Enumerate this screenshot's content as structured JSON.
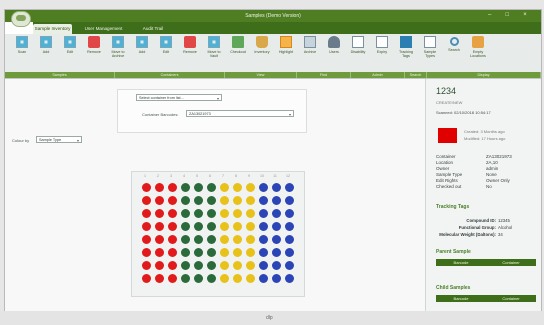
{
  "window": {
    "title": "Samples (Demo Version)",
    "controls": [
      "–",
      "□",
      "×"
    ]
  },
  "tabs": [
    "Sample Inventory",
    "User Management",
    "Audit Trail"
  ],
  "ribbon": {
    "buttons": [
      {
        "label": "Scan",
        "icon": "grid-icon"
      },
      {
        "label": "Add",
        "icon": "grid-icon"
      },
      {
        "label": "Edit",
        "icon": "grid-icon"
      },
      {
        "label": "Remove",
        "icon": "trash-icon"
      },
      {
        "label": "Move to Archive",
        "icon": "grid-icon"
      },
      {
        "label": "Add",
        "icon": "grid-icon"
      },
      {
        "label": "Edit",
        "icon": "grid-icon"
      },
      {
        "label": "Remove",
        "icon": "trash-icon"
      },
      {
        "label": "Move to Vault",
        "icon": "grid-icon"
      },
      {
        "label": "Checkout",
        "icon": "check-icon"
      },
      {
        "label": "Inventory",
        "icon": "bucket-icon"
      },
      {
        "label": "Highlight",
        "icon": "highlight-icon"
      },
      {
        "label": "Archive",
        "icon": "film-icon"
      },
      {
        "label": "Users",
        "icon": "person-icon"
      },
      {
        "label": "Disability",
        "icon": "doc-icon"
      },
      {
        "label": "Expiry",
        "icon": "doc-icon"
      },
      {
        "label": "Tracking Tags",
        "icon": "list-icon"
      },
      {
        "label": "Sample Types",
        "icon": "doc-icon"
      },
      {
        "label": "Search",
        "icon": "search-icon"
      },
      {
        "label": "Empty Locations",
        "icon": "box-icon"
      }
    ],
    "groups": [
      "Samples",
      "Containers",
      "View",
      "Find",
      "Admin",
      "Search",
      "Display"
    ]
  },
  "main": {
    "container_select_placeholder": "Select container from list...",
    "container_barcodes_label": "Container Barcodes:",
    "container_barcodes_value": "ZA13021973",
    "colour_by_label": "Colour by",
    "colour_by_value": "Sample Type",
    "plate": {
      "columns": [
        "1",
        "2",
        "3",
        "4",
        "5",
        "6",
        "7",
        "8",
        "9",
        "10",
        "11",
        "12"
      ],
      "rows": 8,
      "colors": [
        "#e11b1b",
        "#e11b1b",
        "#e11b1b",
        "#2b6a3a",
        "#2b6a3a",
        "#2b6a3a",
        "#e8c21a",
        "#e8c21a",
        "#e8c21a",
        "#2b45b6",
        "#2b45b6",
        "#2b45b6"
      ]
    }
  },
  "sidebar": {
    "sample_id": "1234",
    "created_label": "CREATE/NEW",
    "scanned": "Scanned: 02/10/2018 10:54:17",
    "created_ago": "Created: 3 Months ago",
    "modified_ago": "Modified: 17 Hours ago",
    "info": [
      {
        "k": "Container",
        "v": "ZA13021973"
      },
      {
        "k": "Location",
        "v": "2A,10"
      },
      {
        "k": "Owner",
        "v": "admin"
      },
      {
        "k": "Sample Type",
        "v": "None"
      },
      {
        "k": "Edit Rights",
        "v": "Owner Only"
      },
      {
        "k": "Checked out",
        "v": "No"
      }
    ],
    "tracking_title": "Tracking Tags",
    "tags": [
      {
        "k": "Compound ID:",
        "v": "12345"
      },
      {
        "k": "Functional Group:",
        "v": "Alcohol"
      },
      {
        "k": "Molecular Weight (Daltons):",
        "v": "34"
      }
    ],
    "parent_title": "Parent Sample",
    "parent_cols": [
      "Barcode",
      "Container"
    ],
    "child_title": "Child Samples",
    "child_cols": [
      "Barcode",
      "Container"
    ]
  },
  "brand": "dlp"
}
